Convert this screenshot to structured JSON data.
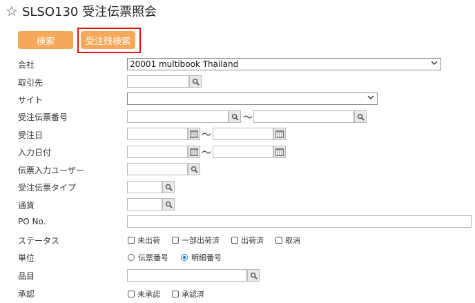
{
  "header": {
    "title": "SLSO130 受注伝票照会",
    "star_icon": "star-outline-icon"
  },
  "buttons": {
    "search": "検索",
    "remaining_search": "受注残検索"
  },
  "fields": {
    "company": {
      "label": "会社",
      "value": "20001 multibook Thailand"
    },
    "partner": {
      "label": "取引先"
    },
    "site": {
      "label": "サイト"
    },
    "order_slip_no": {
      "label": "受注伝票番号",
      "separator": "～"
    },
    "order_date": {
      "label": "受注日",
      "separator": "～"
    },
    "input_date": {
      "label": "入力日付",
      "separator": "～"
    },
    "slip_input_user": {
      "label": "伝票入力ユーザー"
    },
    "order_slip_type": {
      "label": "受注伝票タイプ"
    },
    "currency": {
      "label": "通貨"
    },
    "po_no": {
      "label": "PO No."
    },
    "status": {
      "label": "ステータス",
      "options": [
        "未出荷",
        "一部出荷済",
        "出荷済",
        "取消"
      ]
    },
    "unit": {
      "label": "単位",
      "options": [
        "伝票番号",
        "明細番号"
      ],
      "selected": "明細番号"
    },
    "item": {
      "label": "品目"
    },
    "approval": {
      "label": "承認",
      "options": [
        "未承認",
        "承認済"
      ]
    }
  }
}
